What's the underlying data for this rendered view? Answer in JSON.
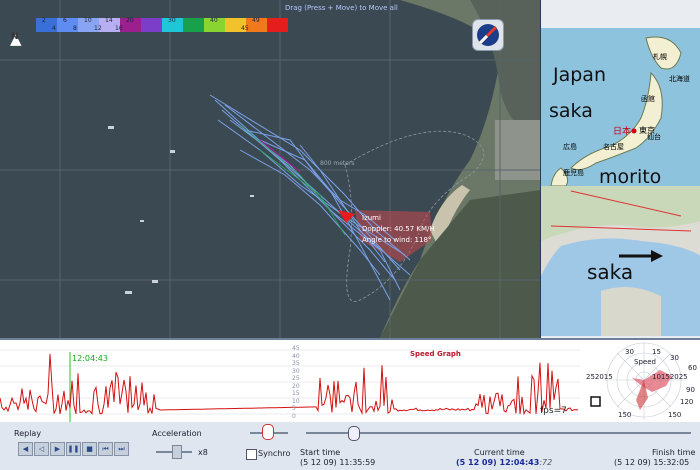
{
  "map_view": {
    "drag_hint": "Drag (Press + Move) to Move all",
    "north_label": "N",
    "legend_colors": [
      "#3a6fd8",
      "#5f8cf0",
      "#8aa4f4",
      "#b6b0f2",
      "#9b1f8f",
      "#7a3ec8",
      "#1ec6d6",
      "#18a04a",
      "#8ad431",
      "#f2c22c",
      "#f07a1b",
      "#e51d1d"
    ],
    "legend_top": [
      "2",
      "6",
      "10",
      "14",
      "20",
      "",
      "30",
      "",
      "40",
      "",
      "49"
    ],
    "legend_bottom": [
      "4",
      "8",
      "12",
      "16",
      "",
      "",
      "",
      "",
      "",
      "45",
      ""
    ],
    "scale_label": "800 meters",
    "compass_icon": "compass-needle-icon",
    "rider": {
      "name": "Izumi",
      "doppler": "Doppler: 40.57 KM/H",
      "angle": "Angle to wind: 118°"
    }
  },
  "maps": {
    "japan_label": "Japan",
    "saka_label_1": "saka",
    "morito_label": "morito",
    "saka_label_2": "saka",
    "cities": [
      "札幌",
      "函館",
      "仙台",
      "日本",
      "東京",
      "広島",
      "名古屋",
      "鹿児島",
      "北海道"
    ]
  },
  "speed_graph": {
    "title": "Speed Graph",
    "cursor_time": "12:04:43",
    "fps": "fps=7",
    "y_ticks": [
      "45",
      "40",
      "35",
      "30",
      "25",
      "20",
      "15",
      "10",
      "5",
      "0"
    ]
  },
  "polar": {
    "labels": [
      "30",
      "15",
      "30",
      "252015",
      "10152025",
      "30",
      "15",
      "60",
      "90",
      "120",
      "150",
      "60",
      "30",
      "120",
      "150",
      "Speed"
    ]
  },
  "controls": {
    "replay_label": "Replay",
    "acceleration_label": "Acceleration",
    "accel_value": "x8",
    "synchro_label": "Synchro",
    "start_label": "Start time",
    "start_value": "(5 12 09) 11:35:59",
    "current_label": "Current time",
    "current_date": "(5 12 09)",
    "current_value": "12:04:43",
    "current_sub": ":72",
    "finish_label": "Finish time",
    "finish_value": "(5 12 09) 15:32:05"
  },
  "colors": {
    "track": "#7aa0e8",
    "graph_line": "#d41010",
    "cursor": "#2bbf2b"
  }
}
